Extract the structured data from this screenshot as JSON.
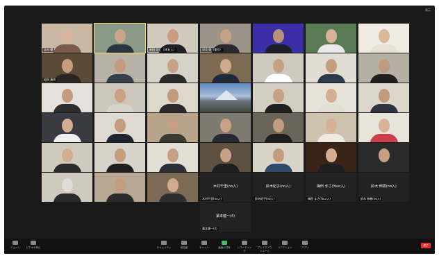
{
  "window": {
    "view_label": "表示"
  },
  "participants": [
    {
      "name": "吉村 櫻",
      "row": 0,
      "col": 0,
      "skin": "#d8b49a",
      "shirt": "#7a5a4a",
      "bg": "#c9b8a3"
    },
    {
      "name": "",
      "row": 0,
      "col": 1,
      "skin": "#c9a58a",
      "shirt": "#2c3440",
      "bg": "#8b9a88",
      "active": true
    },
    {
      "name": "新田 浩仁（SKＢ入）",
      "row": 0,
      "col": 2,
      "skin": "#c79e7e",
      "shirt": "#1e2228",
      "bg": "#d2cbbd"
    },
    {
      "name": "深見 健（東京）",
      "row": 0,
      "col": 3,
      "skin": "#c5a186",
      "shirt": "#2a2a2e",
      "bg": "#9c9489"
    },
    {
      "name": "",
      "row": 0,
      "col": 4,
      "skin": "#b8917a",
      "shirt": "#1f1f2b",
      "bg": "#3b2fa8"
    },
    {
      "name": "",
      "row": 0,
      "col": 5,
      "skin": "#d6b297",
      "shirt": "#eaeaea",
      "bg": "#5a7a56"
    },
    {
      "name": "",
      "row": 0,
      "col": 6,
      "skin": "#d9b79b",
      "shirt": "#e8e0d5",
      "bg": "#f0ece4"
    },
    {
      "name": "岩田 真也",
      "row": 1,
      "col": 0,
      "skin": "#c79d7e",
      "shirt": "#2a2620",
      "bg": "#5a4a36"
    },
    {
      "name": "",
      "row": 1,
      "col": 1,
      "skin": "#c49a7c",
      "shirt": "#36404a",
      "bg": "#b8b2a6"
    },
    {
      "name": "",
      "row": 1,
      "col": 2,
      "skin": "#c9a286",
      "shirt": "#2b2b2b",
      "bg": "#d7d2c8"
    },
    {
      "name": "",
      "row": 1,
      "col": 3,
      "skin": "#d1aa8c",
      "shirt": "#1e2a3a",
      "bg": "#7e6a52"
    },
    {
      "name": "",
      "row": 1,
      "col": 4,
      "skin": "#c7a083",
      "shirt": "#ffffff",
      "bg": "#cfc9bf"
    },
    {
      "name": "",
      "row": 1,
      "col": 5,
      "skin": "#c49c7e",
      "shirt": "#2f3a48",
      "bg": "#e2ddd3"
    },
    {
      "name": "",
      "row": 1,
      "col": 6,
      "skin": "#c09a7e",
      "shirt": "#1e1e1e",
      "bg": "#b6b0a4"
    },
    {
      "name": "",
      "row": 2,
      "col": 0,
      "skin": "#c49b7c",
      "shirt": "#2d2d2d",
      "bg": "#e5e1da"
    },
    {
      "name": "",
      "row": 2,
      "col": 1,
      "skin": "#c9a286",
      "shirt": "#d8d4cc",
      "bg": "#cdc6bb"
    },
    {
      "name": "",
      "row": 2,
      "col": 2,
      "skin": "#c29a7c",
      "shirt": "#2a2a2a",
      "bg": "#ddd7cc"
    },
    {
      "name": "",
      "row": 2,
      "col": 3,
      "landscape": true
    },
    {
      "name": "",
      "row": 2,
      "col": 4,
      "skin": "#c8a084",
      "shirt": "#1f1f1f",
      "bg": "#d3cdc2"
    },
    {
      "name": "",
      "row": 2,
      "col": 5,
      "skin": "#d3ae92",
      "shirt": "#e4ddd3",
      "bg": "#e8e3da"
    },
    {
      "name": "",
      "row": 2,
      "col": 6,
      "skin": "#c29b7d",
      "shirt": "#2e3540",
      "bg": "#dcd6cb"
    },
    {
      "name": "",
      "row": 3,
      "col": 0,
      "skin": "#d2ad90",
      "shirt": "#f0f0f0",
      "bg": "#3a3a42"
    },
    {
      "name": "",
      "row": 3,
      "col": 1,
      "skin": "#c49c7e",
      "shirt": "#1f2630",
      "bg": "#e0dbd2"
    },
    {
      "name": "",
      "row": 3,
      "col": 2,
      "skin": "#c7a084",
      "shirt": "#3a3a30",
      "bg": "#b8a48a"
    },
    {
      "name": "",
      "row": 3,
      "col": 3,
      "skin": "#c9a286",
      "shirt": "#252a30",
      "bg": "#7e7a70"
    },
    {
      "name": "",
      "row": 3,
      "col": 4,
      "skin": "#c39b7d",
      "shirt": "#1e1e1e",
      "bg": "#6b6458"
    },
    {
      "name": "",
      "row": 3,
      "col": 5,
      "skin": "#d6b195",
      "shirt": "#efe9e0",
      "bg": "#cfc3b0"
    },
    {
      "name": "",
      "row": 3,
      "col": 6,
      "skin": "#d8b397",
      "shirt": "#c9404a",
      "bg": "#e8e4dc"
    },
    {
      "name": "",
      "row": 4,
      "col": 0,
      "skin": "#d2ad90",
      "shirt": "#2a2a2a",
      "bg": "#cfc9be"
    },
    {
      "name": "",
      "row": 4,
      "col": 1,
      "skin": "#c49c7e",
      "shirt": "#1e1e1e",
      "bg": "#d8d3ca"
    },
    {
      "name": "",
      "row": 4,
      "col": 2,
      "skin": "#c7a083",
      "shirt": "#2b2f36",
      "bg": "#e3ded6"
    },
    {
      "name": "",
      "row": 4,
      "col": 3,
      "skin": "#c8a185",
      "shirt": "#1f1f1f",
      "bg": "#5e5040"
    },
    {
      "name": "",
      "row": 4,
      "col": 4,
      "skin": "#c39b7d",
      "shirt": "#2e4a6a",
      "bg": "#d9d3c8"
    },
    {
      "name": "",
      "row": 4,
      "col": 5,
      "skin": "#d4ae91",
      "shirt": "#1f1f1f",
      "bg": "#3a2418"
    },
    {
      "name": "",
      "row": 4,
      "col": 6,
      "skin": "#c79f82",
      "shirt": "#2a2a2a",
      "bg": "#2b2b2b"
    },
    {
      "name": "",
      "row": 5,
      "col": 0,
      "skin": "#e0dcd6",
      "shirt": "#2a2a2a",
      "bg": "#cfc9be"
    },
    {
      "name": "",
      "row": 5,
      "col": 1,
      "skin": "#c49c7e",
      "shirt": "#2a2a2a",
      "bg": "#b7a793"
    },
    {
      "name": "",
      "row": 5,
      "col": 2,
      "skin": "#d1ab8f",
      "shirt": "#2e2e2e",
      "bg": "#7c6a56"
    },
    {
      "name": "",
      "row": 5,
      "col": 3,
      "videoOff": true,
      "display": "木村千里(no入)"
    },
    {
      "name": "",
      "row": 5,
      "col": 4,
      "videoOff": true,
      "display": "鈴木紀子(no入)"
    },
    {
      "name": "",
      "row": 5,
      "col": 5,
      "videoOff": true,
      "display": "梅田 まさ(Your入)"
    },
    {
      "name": "",
      "row": 5,
      "col": 6,
      "videoOff": true,
      "display": "鈴木 伸樹(no入)"
    },
    {
      "name": "",
      "row": 6,
      "col": 3,
      "videoOff": true,
      "display": "葉本健一(4)"
    }
  ],
  "toolbar": {
    "left": [
      {
        "label": "ミュート",
        "icon": "microphone-icon"
      },
      {
        "label": "ビデオの停止",
        "icon": "video-camera-icon"
      }
    ],
    "center": [
      {
        "label": "セキュリティ",
        "icon": "shield-icon"
      },
      {
        "label": "参加者",
        "icon": "participants-icon"
      },
      {
        "label": "チャット",
        "icon": "chat-icon"
      },
      {
        "label": "画面の共有",
        "icon": "share-screen-icon",
        "green": true
      },
      {
        "label": "レコーディング",
        "icon": "record-icon"
      },
      {
        "label": "ブレイクアウトルーム",
        "icon": "breakout-icon"
      },
      {
        "label": "リアクション",
        "icon": "reaction-icon"
      },
      {
        "label": "アプリ",
        "icon": "apps-icon"
      }
    ],
    "end_label": "終了"
  }
}
